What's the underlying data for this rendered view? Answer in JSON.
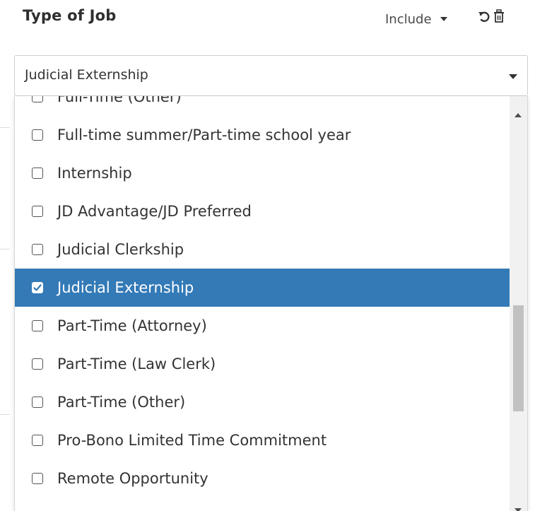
{
  "header": {
    "title": "Type of Job",
    "mode_label": "Include"
  },
  "select": {
    "value": "Judicial Externship"
  },
  "options": [
    {
      "label": "Full-Time (Other)",
      "checked": false
    },
    {
      "label": "Full-time summer/Part-time school year",
      "checked": false
    },
    {
      "label": "Internship",
      "checked": false
    },
    {
      "label": "JD Advantage/JD Preferred",
      "checked": false
    },
    {
      "label": "Judicial Clerkship",
      "checked": false
    },
    {
      "label": "Judicial Externship",
      "checked": true
    },
    {
      "label": "Part-Time (Attorney)",
      "checked": false
    },
    {
      "label": "Part-Time (Law Clerk)",
      "checked": false
    },
    {
      "label": "Part-Time (Other)",
      "checked": false
    },
    {
      "label": "Pro-Bono Limited Time Commitment",
      "checked": false
    },
    {
      "label": "Remote Opportunity",
      "checked": false
    }
  ],
  "colors": {
    "selected_bg": "#337ab7",
    "selected_text": "#ffffff",
    "title_text": "#2e2e2e"
  },
  "icons": {
    "mode_caret": "caret-down-icon",
    "reset": "reset-icon",
    "delete": "trash-icon",
    "select_caret": "chevron-down-icon"
  }
}
